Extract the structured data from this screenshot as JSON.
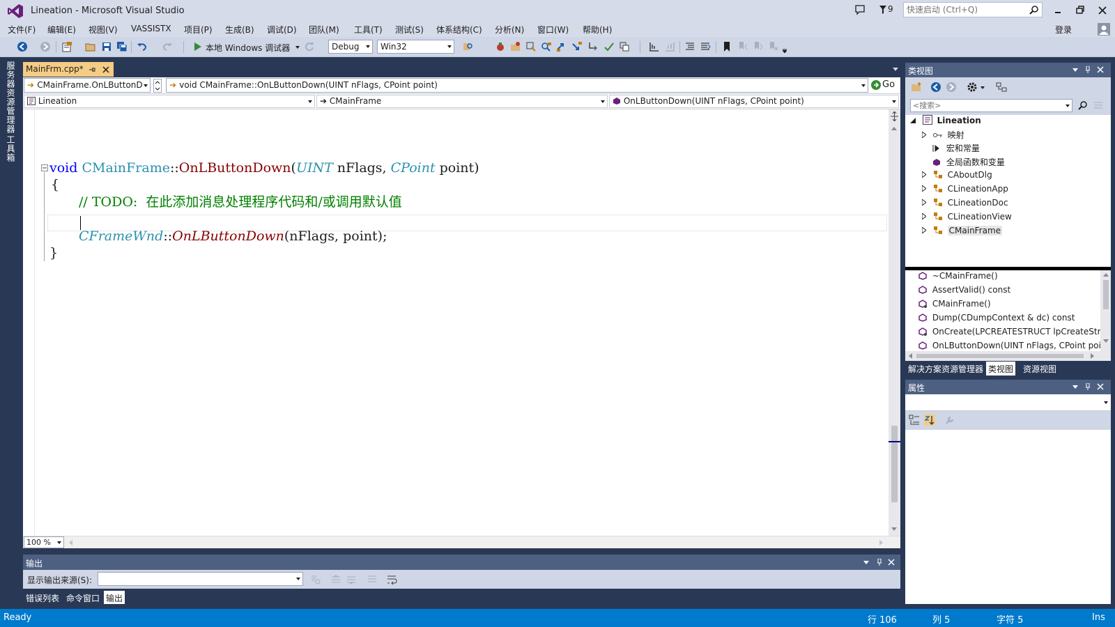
{
  "window": {
    "title": "Lineation - Microsoft Visual Studio",
    "notifications": "9",
    "quick_launch_placeholder": "快速启动 (Ctrl+Q)",
    "signin": "登录"
  },
  "menu": [
    "文件(F)",
    "编辑(E)",
    "视图(V)",
    "VASSISTX",
    "项目(P)",
    "生成(B)",
    "调试(D)",
    "团队(M)",
    "工具(T)",
    "测试(S)",
    "体系结构(C)",
    "分析(N)",
    "窗口(W)",
    "帮助(H)"
  ],
  "toolbar": {
    "debugger_label": "本地 Windows 调试器",
    "config": "Debug",
    "platform": "Win32"
  },
  "left_strip": {
    "server_explorer": "服务器资源管理器",
    "toolbox": "工具箱"
  },
  "editor": {
    "tab_label": "MainFrm.cpp*",
    "nav1_scope": "CMainFrame.OnLButtonD",
    "nav1_function": "void CMainFrame::OnLButtonDown(UINT nFlags, CPoint point)",
    "go_label": "Go",
    "nav2_project": "Lineation",
    "nav2_class": "CMainFrame",
    "nav2_member": "OnLButtonDown(UINT nFlags, CPoint point)",
    "zoom": "100 %",
    "code": {
      "kw_void": "void",
      "cls": "CMainFrame",
      "sep": "::",
      "fn": "OnLButtonDown",
      "paren_open": "(",
      "t1": "UINT",
      "p1": " nFlags, ",
      "t2": "CPoint",
      "p2": " point)",
      "brace_open": "{",
      "comment": "// TODO:  在此添加消息处理程序代码和/或调用默认值",
      "base": "CFrameWnd",
      "sep2": "::",
      "call": "OnLButtonDown",
      "args": "(nFlags, point);",
      "brace_close": "}"
    }
  },
  "output": {
    "title": "输出",
    "source_label": "显示输出来源(S):"
  },
  "bottom_tabs": [
    "错误列表",
    "命令窗口",
    "输出"
  ],
  "classview": {
    "title": "类视图",
    "search_placeholder": "<搜索>",
    "tree": [
      {
        "label": "Lineation",
        "bold": true
      },
      {
        "label": "映射"
      },
      {
        "label": "宏和常量"
      },
      {
        "label": "全局函数和变量"
      },
      {
        "label": "CAboutDlg"
      },
      {
        "label": "CLineationApp"
      },
      {
        "label": "CLineationDoc"
      },
      {
        "label": "CLineationView"
      },
      {
        "label": "CMainFrame"
      }
    ],
    "members": [
      "~CMainFrame()",
      "AssertValid() const",
      "CMainFrame()",
      "Dump(CDumpContext & dc) const",
      "OnCreate(LPCREATESTRUCT lpCreateStru",
      "OnLButtonDown(UINT nFlags, CPoint poi"
    ]
  },
  "right_tabs": [
    "解决方案资源管理器",
    "类视图",
    "资源视图"
  ],
  "properties": {
    "title": "属性"
  },
  "status": {
    "ready": "Ready",
    "line": "行 106",
    "col": "列 5",
    "char": "字符 5",
    "ins": "Ins"
  },
  "colors": {
    "accent": "#007acc",
    "keyword": "#0000ff",
    "type": "#2b91af",
    "comment": "#008000",
    "function": "#880000",
    "tab_active": "#f5cc84"
  }
}
